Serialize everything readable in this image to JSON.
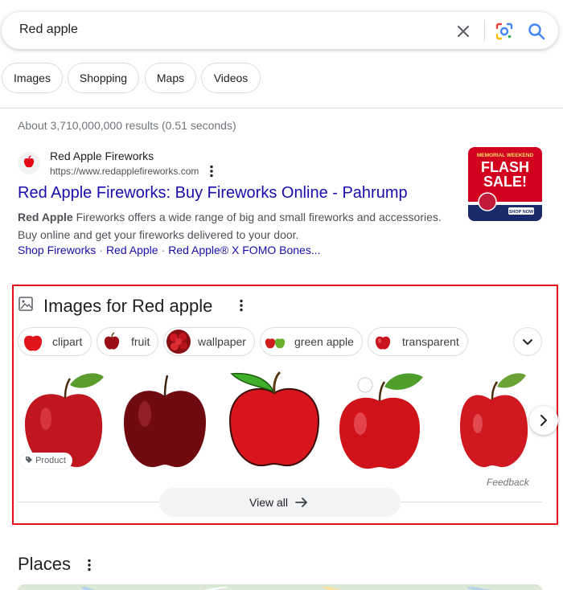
{
  "search": {
    "query": "Red apple"
  },
  "chips": [
    "Images",
    "Shopping",
    "Maps",
    "Videos"
  ],
  "stats": "About 3,710,000,000 results (0.51 seconds)",
  "result": {
    "site_name": "Red Apple Fireworks",
    "url": "https://www.redapplefireworks.com",
    "title": "Red Apple Fireworks: Buy Fireworks Online - Pahrump",
    "snippet_bold": "Red Apple",
    "snippet_rest": " Fireworks offers a wide range of big and small fireworks and accessories. Buy online and get your fireworks delivered to your door.",
    "sitelinks": [
      "Shop Fireworks",
      "Red Apple",
      "Red Apple® X FOMO Bones..."
    ],
    "thumb": {
      "top_line": "MEMORIAL WEEKEND",
      "line1": "FLASH",
      "line2": "SALE!",
      "button": "SHOP NOW"
    }
  },
  "images_section": {
    "title": "Images for Red apple",
    "filters": [
      "clipart",
      "fruit",
      "wallpaper",
      "green apple",
      "transparent"
    ],
    "product_badge": "Product",
    "feedback": "Feedback",
    "view_all": "View all"
  },
  "places": {
    "title": "Places"
  },
  "colors": {
    "link": "#1a0dab",
    "highlight_border": "#e3121a",
    "accent_blue": "#1a73e8"
  },
  "icons": {
    "clear": "close-icon",
    "lens": "google-lens-icon",
    "search": "search-icon",
    "more": "three-dot-menu-icon",
    "images": "image-icon",
    "expand": "chevron-down-icon",
    "next": "chevron-right-icon",
    "arrow": "arrow-right-icon",
    "tag": "tag-icon"
  }
}
